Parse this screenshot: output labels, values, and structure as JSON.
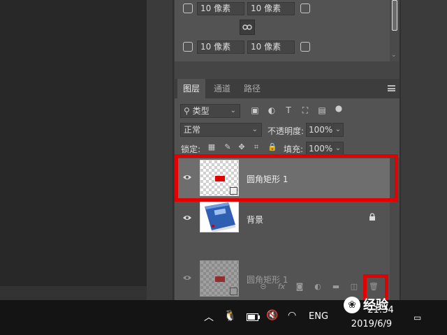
{
  "properties": {
    "radius_unit_value": "10 像素",
    "link_icon": "chain-link-icon"
  },
  "layers_panel": {
    "tabs": [
      {
        "label": "图层"
      },
      {
        "label": "通道"
      },
      {
        "label": "路径"
      }
    ],
    "filter": {
      "label": "类型",
      "icon": "search-icon"
    },
    "blend_mode": "正常",
    "opacity_label": "不透明度:",
    "opacity_value": "100%",
    "lock_label": "锁定:",
    "fill_label": "填充:",
    "fill_value": "100%",
    "layers": [
      {
        "name": "圆角矩形 1",
        "selected": true,
        "visible": true
      },
      {
        "name": "背景",
        "selected": false,
        "visible": true,
        "locked": true
      }
    ],
    "ghost_layer": {
      "name": "圆角矩形 1"
    }
  },
  "taskbar": {
    "language": "ENG",
    "time": "21:34",
    "date": "2019/6/9"
  },
  "watermark": {
    "text": "经验"
  },
  "colors": {
    "highlight": "#e30000",
    "selected_row": "#6e6e6e",
    "panel": "#535353"
  }
}
